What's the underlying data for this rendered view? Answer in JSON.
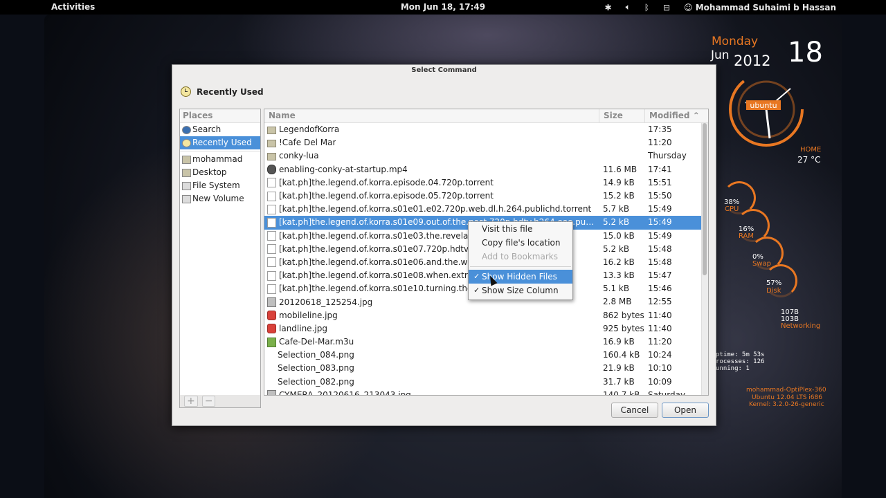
{
  "topbar": {
    "activities": "Activities",
    "clock": "Mon Jun 18, 17:49",
    "user": "Mohammad Suhaimi b Hassan",
    "tray_icons": [
      "accessibility-icon",
      "volume-icon",
      "bluetooth-icon",
      "network-icon",
      "user-icon"
    ]
  },
  "conky": {
    "day": "Monday",
    "month": "Jun",
    "year": "2012",
    "date": "18",
    "logo": "ubuntu",
    "weather_label": "HOME",
    "temperature": "27 °C",
    "cpu_pct": "38%",
    "cpu_label": "CPU",
    "ram_pct": "16%",
    "ram_label": "RAM",
    "swap_pct": "0%",
    "swap_label": "Swap",
    "disk_pct": "57%",
    "disk_label": "Disk",
    "net_up": "107B",
    "net_down": "103B",
    "net_label": "Networking",
    "uptime": "ptime: 5m 53s",
    "processes": "rocesses: 126",
    "running": "unning: 1",
    "host": "mohammad-OptiPlex-360",
    "os": "Ubuntu 12.04 LTS  i686",
    "kernel": "Kernel: 3.2.0-26-generic",
    "accent": "#e87722"
  },
  "dialog": {
    "title": "Select Command",
    "location": "Recently Used",
    "places_header": "Places",
    "places": [
      {
        "label": "Search",
        "icon": "search-icon"
      },
      {
        "label": "Recently Used",
        "icon": "clock-icon",
        "selected": true
      },
      {
        "label": "mohammad",
        "icon": "folder-icon"
      },
      {
        "label": "Desktop",
        "icon": "folder-icon"
      },
      {
        "label": "File System",
        "icon": "drive-icon"
      },
      {
        "label": "New Volume",
        "icon": "drive-icon"
      }
    ],
    "places_add": "+",
    "places_remove": "−",
    "columns": {
      "name": "Name",
      "size": "Size",
      "modified": "Modified"
    },
    "files": [
      {
        "name": "LegendofKorra",
        "size": "",
        "modified": "17:35",
        "icon": "folder"
      },
      {
        "name": "!Cafe Del Mar",
        "size": "",
        "modified": "11:20",
        "icon": "folder"
      },
      {
        "name": "conky-lua",
        "size": "",
        "modified": "Thursday",
        "icon": "folder"
      },
      {
        "name": "enabling-conky-at-startup.mp4",
        "size": "11.6 MB",
        "modified": "17:41",
        "icon": "video"
      },
      {
        "name": "[kat.ph]the.legend.of.korra.episode.04.720p.torrent",
        "size": "14.9 kB",
        "modified": "15:51",
        "icon": "doc"
      },
      {
        "name": "[kat.ph]the.legend.of.korra.episode.05.720p.torrent",
        "size": "15.2 kB",
        "modified": "15:50",
        "icon": "doc"
      },
      {
        "name": "[kat.ph]the.legend.of.korra.s01e01.e02.720p.web.dl.h.264.publichd.torrent",
        "size": "5.7 kB",
        "modified": "15:49",
        "icon": "doc"
      },
      {
        "name": "[kat.ph]the.legend.of.korra.s01e09.out.of.the.past.720p.hdtv.h264.ooo.publi...",
        "size": "5.2 kB",
        "modified": "15:49",
        "icon": "doc",
        "selected": true
      },
      {
        "name": "[kat.ph]the.legend.of.korra.s01e03.the.revelati                        nt",
        "size": "15.0 kB",
        "modified": "15:49",
        "icon": "doc"
      },
      {
        "name": "[kat.ph]the.legend.of.korra.s01e07.720p.hdtv.h",
        "size": "5.2 kB",
        "modified": "15:48",
        "icon": "doc"
      },
      {
        "name": "[kat.ph]the.legend.of.korra.s01e06.and.the.win                       rrent",
        "size": "16.2 kB",
        "modified": "15:48",
        "icon": "doc"
      },
      {
        "name": "[kat.ph]the.legend.of.korra.s01e08.when.extre                      opul...",
        "size": "13.3 kB",
        "modified": "15:47",
        "icon": "doc"
      },
      {
        "name": "[kat.ph]the.legend.of.korra.s01e10.turning.the.                        .m...",
        "size": "5.1 kB",
        "modified": "15:46",
        "icon": "doc"
      },
      {
        "name": "20120618_125254.jpg",
        "size": "2.8 MB",
        "modified": "12:55",
        "icon": "img"
      },
      {
        "name": "mobileline.jpg",
        "size": "862 bytes",
        "modified": "11:40",
        "icon": "phone"
      },
      {
        "name": "landline.jpg",
        "size": "925 bytes",
        "modified": "11:40",
        "icon": "phone"
      },
      {
        "name": "Cafe-Del-Mar.m3u",
        "size": "16.9 kB",
        "modified": "11:20",
        "icon": "audio"
      },
      {
        "name": "Selection_084.png",
        "size": "160.4 kB",
        "modified": "10:24",
        "icon": "blank"
      },
      {
        "name": "Selection_083.png",
        "size": "21.9 kB",
        "modified": "10:10",
        "icon": "blank"
      },
      {
        "name": "Selection_082.png",
        "size": "31.7 kB",
        "modified": "10:09",
        "icon": "blank"
      },
      {
        "name": "CYMERA_20120616_213043.jpg",
        "size": "140.7 kB",
        "modified": "Saturday",
        "icon": "img"
      }
    ],
    "cancel": "Cancel",
    "open": "Open"
  },
  "context_menu": {
    "items": [
      {
        "label": "Visit this file",
        "disabled": false
      },
      {
        "label": "Copy file's location",
        "disabled": false
      },
      {
        "label": "Add to Bookmarks",
        "disabled": true
      },
      {
        "separator": true
      },
      {
        "label": "Show Hidden Files",
        "checked": true,
        "highlighted": true
      },
      {
        "label": "Show Size Column",
        "checked": true
      }
    ],
    "check_glyph": "✓"
  }
}
